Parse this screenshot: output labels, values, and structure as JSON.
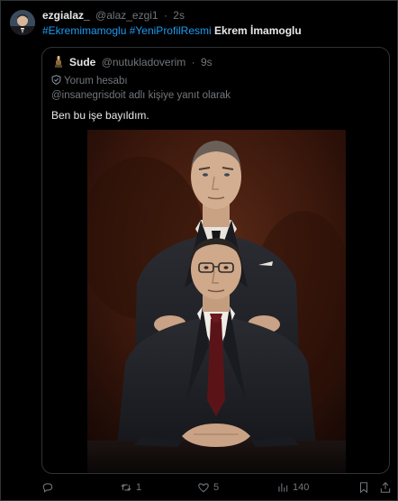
{
  "tweet": {
    "display_name": "ezgialaz_",
    "handle": "@alaz_ezgi1",
    "separator": "·",
    "time": "2s",
    "hashtag1": "#Ekremimamoglu",
    "hashtag2": "#YeniProfilResmi",
    "text_bold": "Ekrem İmamoglu"
  },
  "quote": {
    "display_name": "Sude",
    "handle": "@nutukladoverim",
    "separator": "·",
    "time": "9s",
    "label": "Yorum hesabı",
    "reply_context": "@insanegrisdoit adlı kişiye yanıt olarak",
    "body": "Ben bu işe bayıldım."
  },
  "actions": {
    "reply_count": "",
    "retweet_count": "1",
    "like_count": "5",
    "views_count": "140"
  },
  "icons": [
    "reply-icon",
    "retweet-icon",
    "heart-icon",
    "views-icon",
    "bookmark-icon",
    "share-icon",
    "shield-icon",
    "sude-avatar-icon"
  ],
  "colors": {
    "accent": "#1d9bf0",
    "muted": "#71767b",
    "text": "#e7e9ea",
    "border": "#2f3336",
    "background": "#000000"
  }
}
